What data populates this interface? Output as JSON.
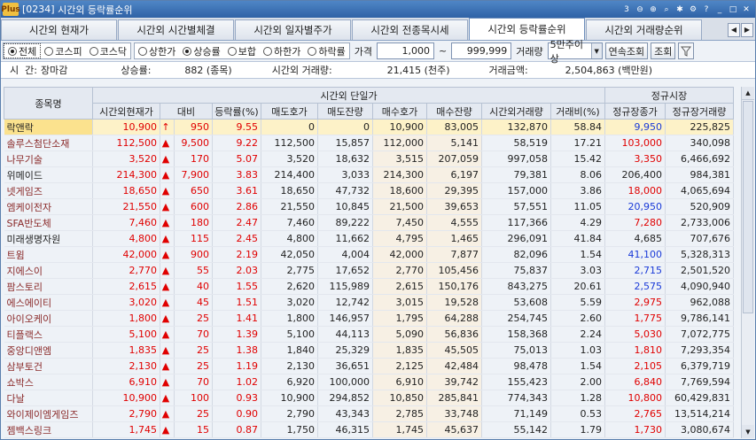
{
  "window": {
    "code": "[0234]",
    "title": "시간외 등락률순위",
    "logo": "Plus"
  },
  "tabs": [
    "시간외 현재가",
    "시간외 시간별체결",
    "시간외 일자별주가",
    "시간외 전종목시세",
    "시간외 등락률순위",
    "시간외 거래량순위"
  ],
  "active_tab": 4,
  "filters": {
    "market": [
      "전체",
      "코스피",
      "코스닥"
    ],
    "market_selected": 0,
    "direction": [
      "상한가",
      "상승률",
      "보합",
      "하한가",
      "하락률"
    ],
    "direction_selected": 1,
    "price_label": "가격",
    "price_from": "1,000",
    "price_sep": "~",
    "price_to": "999,999",
    "volume_label": "거래량",
    "volume_value": "5만주이상",
    "continuous_button": "연속조회",
    "query_button": "조회"
  },
  "summary": {
    "time_label": "시  간:",
    "time_value": "장마감",
    "rise_label": "상승률:",
    "rise_value": "882 (종목)",
    "vol_label": "시간외 거래량:",
    "vol_value": "21,415 (천주)",
    "amount_label": "거래금액:",
    "amount_value": "2,504,863 (백만원)"
  },
  "table": {
    "group_headers": {
      "name": "종목명",
      "after": "시간외 단일가",
      "regular": "정규시장"
    },
    "columns": [
      "시간외현재가",
      "대비",
      "등락률(%)",
      "매도호가",
      "매도잔량",
      "매수호가",
      "매수잔량",
      "시간외거래량",
      "거래비(%)",
      "정규장종가",
      "정규장거래량"
    ],
    "rows": [
      [
        "락앤락",
        "10,900",
        "↑",
        "950",
        "9.55",
        "0",
        "0",
        "10,900",
        "83,005",
        "132,870",
        "58.84",
        "9,950",
        "225,825",
        "b"
      ],
      [
        "솔루스첨단소재",
        "112,500",
        "▲",
        "9,500",
        "9.22",
        "112,500",
        "15,857",
        "112,000",
        "5,141",
        "58,519",
        "17.21",
        "103,000",
        "340,098",
        "r"
      ],
      [
        "나무기술",
        "3,520",
        "▲",
        "170",
        "5.07",
        "3,520",
        "18,632",
        "3,515",
        "207,059",
        "997,058",
        "15.42",
        "3,350",
        "6,466,692",
        "r"
      ],
      [
        "위메이드",
        "214,300",
        "▲",
        "7,900",
        "3.83",
        "214,400",
        "3,033",
        "214,300",
        "6,197",
        "79,381",
        "8.06",
        "206,400",
        "984,381",
        "k"
      ],
      [
        "넷게임즈",
        "18,650",
        "▲",
        "650",
        "3.61",
        "18,650",
        "47,732",
        "18,600",
        "29,395",
        "157,000",
        "3.86",
        "18,000",
        "4,065,694",
        "r"
      ],
      [
        "엠케이전자",
        "21,550",
        "▲",
        "600",
        "2.86",
        "21,550",
        "10,845",
        "21,500",
        "39,653",
        "57,551",
        "11.05",
        "20,950",
        "520,909",
        "b"
      ],
      [
        "SFA반도체",
        "7,460",
        "▲",
        "180",
        "2.47",
        "7,460",
        "89,222",
        "7,450",
        "4,555",
        "117,366",
        "4.29",
        "7,280",
        "2,733,006",
        "r"
      ],
      [
        "미래생명자원",
        "4,800",
        "▲",
        "115",
        "2.45",
        "4,800",
        "11,662",
        "4,795",
        "1,465",
        "296,091",
        "41.84",
        "4,685",
        "707,676",
        "k"
      ],
      [
        "트윔",
        "42,000",
        "▲",
        "900",
        "2.19",
        "42,050",
        "4,004",
        "42,000",
        "7,877",
        "82,096",
        "1.54",
        "41,100",
        "5,328,313",
        "b"
      ],
      [
        "지에스이",
        "2,770",
        "▲",
        "55",
        "2.03",
        "2,775",
        "17,652",
        "2,770",
        "105,456",
        "75,837",
        "3.03",
        "2,715",
        "2,501,520",
        "b"
      ],
      [
        "팜스토리",
        "2,615",
        "▲",
        "40",
        "1.55",
        "2,620",
        "115,989",
        "2,615",
        "150,176",
        "843,275",
        "20.61",
        "2,575",
        "4,090,940",
        "b"
      ],
      [
        "에스에이티",
        "3,020",
        "▲",
        "45",
        "1.51",
        "3,020",
        "12,742",
        "3,015",
        "19,528",
        "53,608",
        "5.59",
        "2,975",
        "962,088",
        "r"
      ],
      [
        "아이오케이",
        "1,800",
        "▲",
        "25",
        "1.41",
        "1,800",
        "146,957",
        "1,795",
        "64,288",
        "254,745",
        "2.60",
        "1,775",
        "9,786,141",
        "r"
      ],
      [
        "티플랙스",
        "5,100",
        "▲",
        "70",
        "1.39",
        "5,100",
        "44,113",
        "5,090",
        "56,836",
        "158,368",
        "2.24",
        "5,030",
        "7,072,775",
        "r"
      ],
      [
        "중앙디앤엠",
        "1,835",
        "▲",
        "25",
        "1.38",
        "1,840",
        "25,329",
        "1,835",
        "45,505",
        "75,013",
        "1.03",
        "1,810",
        "7,293,354",
        "r"
      ],
      [
        "삼부토건",
        "2,130",
        "▲",
        "25",
        "1.19",
        "2,130",
        "36,651",
        "2,125",
        "42,484",
        "98,478",
        "1.54",
        "2,105",
        "6,379,719",
        "r"
      ],
      [
        "쇼박스",
        "6,910",
        "▲",
        "70",
        "1.02",
        "6,920",
        "100,000",
        "6,910",
        "39,742",
        "155,423",
        "2.00",
        "6,840",
        "7,769,594",
        "r"
      ],
      [
        "다날",
        "10,900",
        "▲",
        "100",
        "0.93",
        "10,900",
        "294,852",
        "10,850",
        "285,841",
        "774,343",
        "1.28",
        "10,800",
        "60,429,831",
        "r"
      ],
      [
        "와이제이엠게임즈",
        "2,790",
        "▲",
        "25",
        "0.90",
        "2,790",
        "43,343",
        "2,785",
        "33,748",
        "71,149",
        "0.53",
        "2,765",
        "13,514,214",
        "r"
      ],
      [
        "젬백스링크",
        "1,745",
        "▲",
        "15",
        "0.87",
        "1,750",
        "46,315",
        "1,745",
        "45,637",
        "55,142",
        "1.79",
        "1,730",
        "3,080,674",
        "r"
      ]
    ]
  },
  "colors": {
    "up": "#e00000",
    "blue": "#1a3ad8",
    "highlight": "#fbe28e"
  }
}
